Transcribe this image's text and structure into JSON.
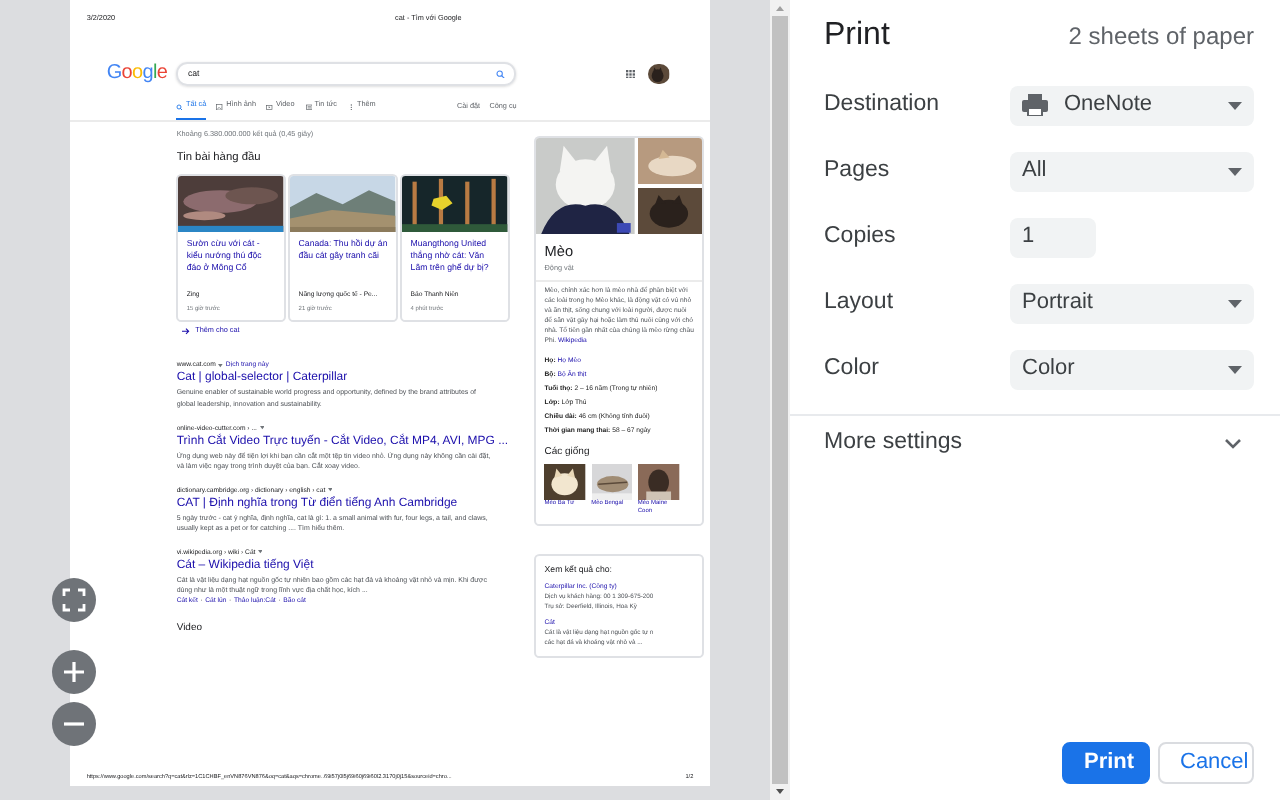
{
  "preview": {
    "header_date": "3/2/2020",
    "header_title": "cat - Tìm với Google",
    "google": {
      "logo": "Google",
      "query": "cat",
      "tabs": [
        {
          "label": "Tất cả",
          "selected": true
        },
        {
          "label": "Hình ảnh",
          "selected": false
        },
        {
          "label": "Video",
          "selected": false
        },
        {
          "label": "Tin tức",
          "selected": false
        },
        {
          "label": "Thêm",
          "selected": false
        }
      ],
      "tools": [
        "Cài đặt",
        "Công cụ"
      ]
    },
    "result_stats": "Khoảng 6.380.000.000 kết quả (0,45 giây)",
    "top_stories": {
      "title": "Tin bài hàng đầu",
      "cards": [
        {
          "title": "Sườn cừu với cát - kiểu nướng thú độc đáo ở Mông Cổ",
          "source": "Zing",
          "time": "15 giờ trước"
        },
        {
          "title": "Canada: Thu hồi dự án đầu cát gây tranh cãi",
          "source": "Năng lượng quốc tế - Pe...",
          "time": "21 giờ trước"
        },
        {
          "title": "Muangthong United thắng nhờ cát: Văn Lâm trên ghế dự bị?",
          "source": "Báo Thanh Niên",
          "time": "4 phút trước"
        }
      ],
      "more": "Thêm cho cat"
    },
    "results": [
      {
        "url": "www.cat.com",
        "translate": "Dịch trang này",
        "title": "Cat | global-selector | Caterpillar",
        "snippet": "Genuine enabler of sustainable world progress and opportunity, defined by the brand attributes of global leadership, innovation and sustainability."
      },
      {
        "url": "online-video-cutter.com › ...",
        "title": "Trình Cắt Video Trực tuyến - Cắt Video, Cắt MP4, AVI, MPG ...",
        "snippet": "Ứng dụng web này để tiện lợi khi bạn cần cắt một tệp tin video nhỏ. Ứng dụng này không cần cài đặt, và làm việc ngay trong trình duyệt của bạn. Cắt xoay video."
      },
      {
        "url": "dictionary.cambridge.org › dictionary › english › cat",
        "title": "CAT | Định nghĩa trong Từ điển tiếng Anh Cambridge",
        "snippet": "5 ngày trước - cat ý nghĩa, định nghĩa, cat là gì: 1. a small animal with fur, four legs, a tail, and claws, usually kept as a pet or for catching .... Tìm hiểu thêm."
      },
      {
        "url": "vi.wikipedia.org › wiki › Cát",
        "title": "Cát – Wikipedia tiếng Việt",
        "snippet": "Cát là vật liệu dạng hạt nguồn gốc tự nhiên bao gồm các hạt đá và khoáng vật nhỏ và mịn. Khi được dùng như là một thuật ngữ trong lĩnh vực địa chất học, kích ...",
        "links": [
          "Cát kết",
          "Cát lún",
          "Thảo luận:Cát",
          "Bão cát"
        ],
        "separator": "·"
      }
    ],
    "video_heading": "Video",
    "knowledge": {
      "title": "Mèo",
      "subtitle": "Động vật",
      "description": "Mèo, chính xác hơn là mèo nhà để phân biệt với các loài trong họ Mèo khác, là động vật có vú nhỏ và ăn thịt, sống chung với loài người, được nuôi để săn vật gây hại hoặc làm thú nuôi cùng với chó nhà. Tổ tiên gần nhất của chúng là mèo rừng châu Phi.",
      "source": "Wikipedia",
      "facts": [
        {
          "label": "Họ:",
          "value": "Họ Mèo",
          "link": true
        },
        {
          "label": "Bộ:",
          "value": "Bộ Ăn thịt",
          "link": true
        },
        {
          "label": "Tuổi thọ:",
          "value": "2 – 16 năm (Trong tự nhiên)",
          "link": false
        },
        {
          "label": "Lớp:",
          "value": "Lớp Thú",
          "link": false
        },
        {
          "label": "Chiều dài:",
          "value": "46 cm (Không tính đuôi)",
          "link": false
        },
        {
          "label": "Thời gian mang thai:",
          "value": "58 – 67 ngày",
          "link": false
        }
      ],
      "breeds_title": "Các giống",
      "breeds": [
        "Mèo Ba Tư",
        "Mèo Bengal",
        "Mèo Maine Coon"
      ]
    },
    "see_results": {
      "title": "Xem kết quả cho:",
      "items": [
        {
          "title": "Caterpillar Inc. (Công ty)",
          "lines": [
            "Dịch vụ khách hàng: 00 1 309-675-200",
            "Trụ sở: Deerfield, Illinois, Hoa Kỳ"
          ]
        },
        {
          "title": "Cát",
          "lines": [
            "Cát là vật liệu dạng hạt nguồn gốc tự n",
            "các hạt đá và khoáng vật nhỏ và ..."
          ]
        }
      ]
    },
    "footer_url": "https://www.google.com/search?q=cat&rlz=1C1CHBF_enVN876VN876&oq=cat&aqs=chrome..69i57j0l5j69i60j69i60l2.3170j0j15&sourceid=chro...",
    "page_number": "1/2"
  },
  "print": {
    "title": "Print",
    "sheets": "2 sheets of paper",
    "settings": [
      {
        "label": "Destination",
        "kind": "destination",
        "value": "OneNote"
      },
      {
        "label": "Pages",
        "kind": "select",
        "value": "All"
      },
      {
        "label": "Copies",
        "kind": "number",
        "value": "1"
      },
      {
        "label": "Layout",
        "kind": "select",
        "value": "Portrait"
      },
      {
        "label": "Color",
        "kind": "select",
        "value": "Color"
      }
    ],
    "more_settings": "More settings",
    "buttons": [
      {
        "label": "Print",
        "kind": "primary"
      },
      {
        "label": "Cancel",
        "kind": "secondary"
      }
    ]
  }
}
